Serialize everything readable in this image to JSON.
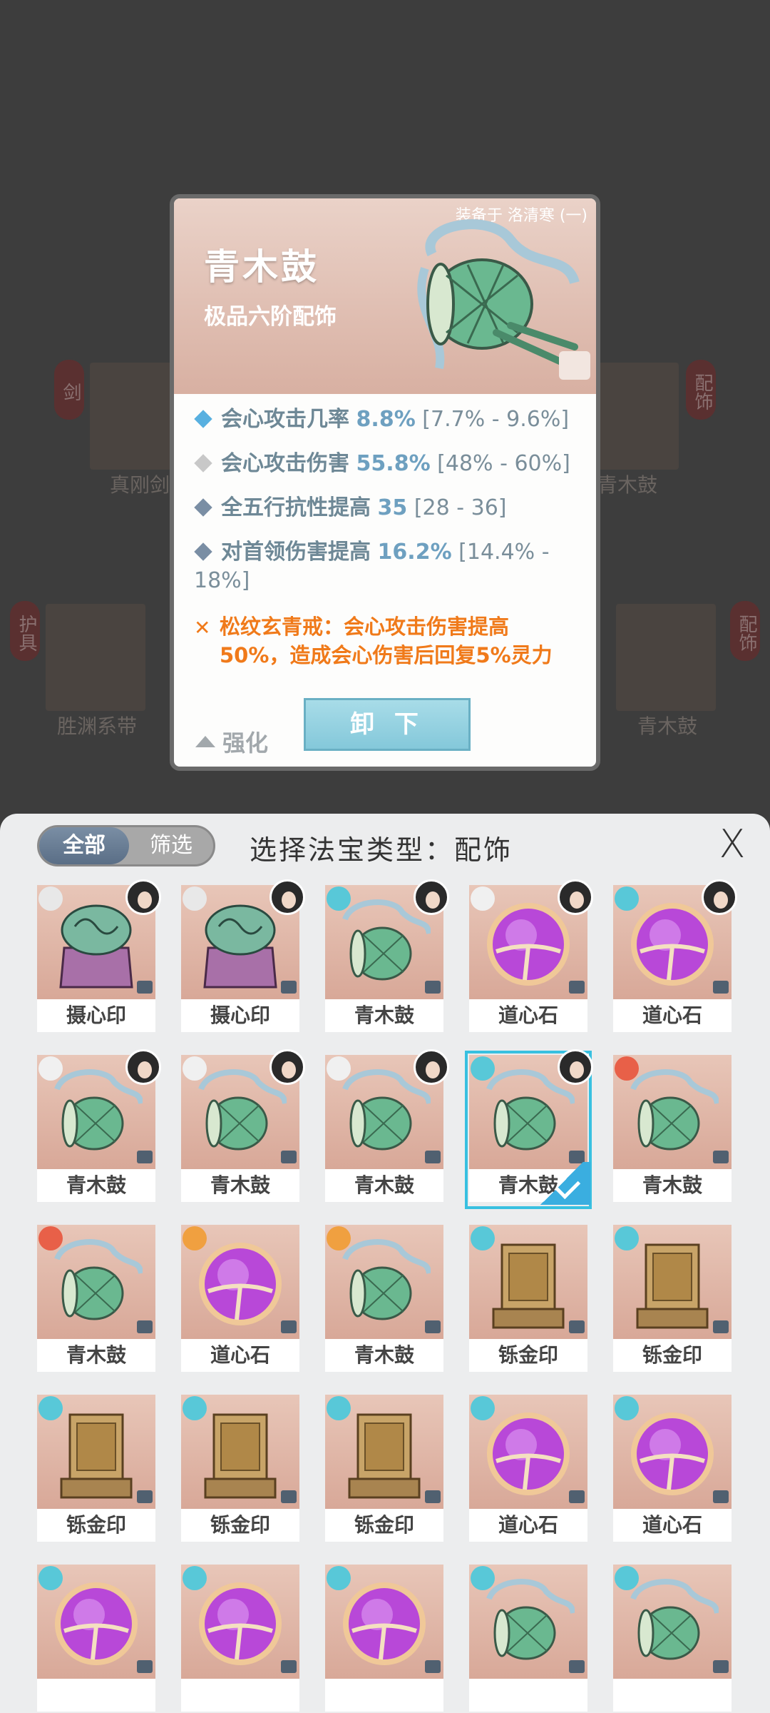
{
  "background": {
    "slots": [
      {
        "label": "剑",
        "name": "真刚剑"
      },
      {
        "label": "配饰",
        "name": "青木鼓"
      },
      {
        "label": "护具",
        "name": "胜渊系带"
      },
      {
        "label": "配饰",
        "name": "青木鼓"
      }
    ]
  },
  "detail": {
    "equipped_on": "装备于 洛清寒 (一)",
    "name": "青木鼓",
    "grade": "极品六阶配饰",
    "stats": [
      {
        "label": "会心攻击几率",
        "value": "8.8%",
        "range": "[7.7% - 9.6%]",
        "color": "#58b0e0"
      },
      {
        "label": "会心攻击伤害",
        "value": "55.8%",
        "range": "[48% - 60%]",
        "color": "#c8c8c8"
      },
      {
        "label": "全五行抗性提高",
        "value": "35",
        "range": "[28 - 36]",
        "color": "#7a8ea4"
      },
      {
        "label": "对首领伤害提高",
        "value": "16.2%",
        "range": "[14.4% - 18%]",
        "color": "#7a8ea4"
      }
    ],
    "special": "松纹玄青戒：会心攻击伤害提高50%，造成会心伤害后回复5%灵力",
    "strengthen": "强化",
    "unequip": "卸 下"
  },
  "panel": {
    "tab_all": "全部",
    "tab_filter": "筛选",
    "title": "选择法宝类型：配饰",
    "close": "X"
  },
  "items": [
    {
      "name": "摄心印",
      "type": "seal",
      "elem": "#e8e8e8",
      "avatar": true
    },
    {
      "name": "摄心印",
      "type": "seal",
      "elem": "#e8e8e8",
      "avatar": true
    },
    {
      "name": "青木鼓",
      "type": "drum",
      "elem": "#58c8d8",
      "avatar": true
    },
    {
      "name": "道心石",
      "type": "orb",
      "elem": "#f0f0f0",
      "avatar": true
    },
    {
      "name": "道心石",
      "type": "orb",
      "elem": "#58c8d8",
      "avatar": true
    },
    {
      "name": "青木鼓",
      "type": "drum",
      "elem": "#f0f0f0",
      "avatar": true
    },
    {
      "name": "青木鼓",
      "type": "drum",
      "elem": "#f0f0f0",
      "avatar": true
    },
    {
      "name": "青木鼓",
      "type": "drum",
      "elem": "#f0f0f0",
      "avatar": true
    },
    {
      "name": "青木鼓",
      "type": "drum",
      "elem": "#58c8d8",
      "avatar": true,
      "selected": true
    },
    {
      "name": "青木鼓",
      "type": "drum",
      "elem": "#e86048",
      "avatar": false
    },
    {
      "name": "青木鼓",
      "type": "drum",
      "elem": "#e86048",
      "avatar": false
    },
    {
      "name": "道心石",
      "type": "orb",
      "elem": "#f0a040",
      "avatar": false
    },
    {
      "name": "青木鼓",
      "type": "drum",
      "elem": "#f0a040",
      "avatar": false
    },
    {
      "name": "铄金印",
      "type": "box",
      "elem": "#58c8d8",
      "avatar": false
    },
    {
      "name": "铄金印",
      "type": "box",
      "elem": "#58c8d8",
      "avatar": false
    },
    {
      "name": "铄金印",
      "type": "box",
      "elem": "#58c8d8",
      "avatar": false
    },
    {
      "name": "铄金印",
      "type": "box",
      "elem": "#58c8d8",
      "avatar": false
    },
    {
      "name": "铄金印",
      "type": "box",
      "elem": "#58c8d8",
      "avatar": false
    },
    {
      "name": "道心石",
      "type": "orb",
      "elem": "#58c8d8",
      "avatar": false
    },
    {
      "name": "道心石",
      "type": "orb",
      "elem": "#58c8d8",
      "avatar": false
    },
    {
      "name": "",
      "type": "orb",
      "elem": "#58c8d8",
      "avatar": false
    },
    {
      "name": "",
      "type": "orb",
      "elem": "#58c8d8",
      "avatar": false
    },
    {
      "name": "",
      "type": "orb",
      "elem": "#58c8d8",
      "avatar": false
    },
    {
      "name": "",
      "type": "drum",
      "elem": "#58c8d8",
      "avatar": false
    },
    {
      "name": "",
      "type": "drum",
      "elem": "#58c8d8",
      "avatar": false
    }
  ]
}
